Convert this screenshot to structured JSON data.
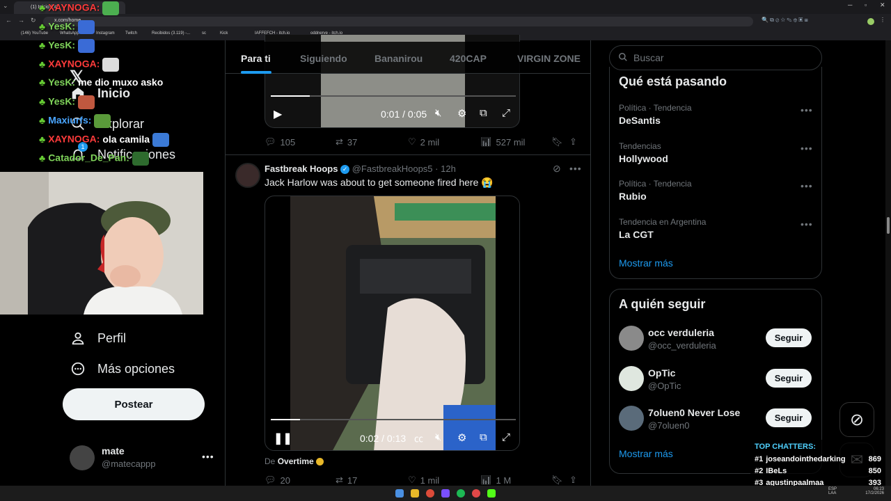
{
  "browser": {
    "tab_title": "(1) Inicio / X",
    "url": "x.com/home",
    "bookmarks": [
      "(146) YouTube",
      "WhatsApp",
      "Instagram",
      "Twitch",
      "Recibidos (3.119) -...",
      "sc",
      "Kick",
      "IAFFEFCH - itch.io",
      "oddnerve - itch.io"
    ]
  },
  "chat": {
    "lines": [
      {
        "user": "XAYNOGA:",
        "msg": "",
        "color": "#ff3b3b",
        "emote": "#4caf50"
      },
      {
        "user": "YesK:",
        "msg": "",
        "color": "#7fd35a",
        "emote": "#3a6bd6"
      },
      {
        "user": "YesK:",
        "msg": "",
        "color": "#7fd35a",
        "emote": "#3a6bd6"
      },
      {
        "user": "XAYNOGA:",
        "msg": "",
        "color": "#ff3b3b",
        "emote": "#dcdcdc"
      },
      {
        "user": "YesK:",
        "msg": "me dio muxo asko",
        "color": "#7fd35a",
        "emote": ""
      },
      {
        "user": "YesK:",
        "msg": "",
        "color": "#7fd35a",
        "emote": "#c0583f"
      },
      {
        "user": "Maxiurfs:",
        "msg": "",
        "color": "#4aa6ff",
        "emote": "#5a9a3a"
      },
      {
        "user": "XAYNOGA:",
        "msg": "ola camila",
        "color": "#ff3b3b",
        "emote": "#3b7ad6"
      },
      {
        "user": "Catador_De_Pan:",
        "msg": "",
        "color": "#7fd35a",
        "emote": "#2e6b2e"
      }
    ]
  },
  "sidebar": {
    "home": "Inicio",
    "explore": "Explorar",
    "notifications": "Notificaciones",
    "notif_count": "1",
    "profile": "Perfil",
    "more": "Más opciones",
    "post": "Postear",
    "account_name": "mate",
    "account_handle": "@matecappp"
  },
  "feed": {
    "tabs": [
      "Para ti",
      "Siguiendo",
      "Bananirou",
      "420CAP",
      "VIRGIN ZONE"
    ],
    "active_tab": "Para ti",
    "post1": {
      "time": "0:01 / 0:05",
      "progress": 0.16,
      "replies": "105",
      "reposts": "37",
      "likes": "2 mil",
      "views": "527 mil"
    },
    "post2": {
      "author": "Fastbreak Hoops",
      "handle": "@FastbreakHoops5",
      "age": "· 12h",
      "text": "Jack Harlow was about to get someone fired here 😭",
      "time": "0:02 / 0:13",
      "progress": 0.12,
      "source_prefix": "De",
      "source": "Overtime",
      "replies": "20",
      "reposts": "17",
      "likes": "1 mil",
      "views": "1 M"
    }
  },
  "right": {
    "search_placeholder": "Buscar",
    "trends_title": "Qué está pasando",
    "trends": [
      {
        "meta": "Política · Tendencia",
        "name": "DeSantis"
      },
      {
        "meta": "Tendencias",
        "name": "Hollywood"
      },
      {
        "meta": "Política · Tendencia",
        "name": "Rubio"
      },
      {
        "meta": "Tendencia en Argentina",
        "name": "La CGT"
      }
    ],
    "trends_more": "Mostrar más",
    "follow_title": "A quién seguir",
    "follow": [
      {
        "name": "occ verduleria",
        "handle": "@occ_verduleria",
        "button": "Seguir",
        "avatar": "#8a8a8a"
      },
      {
        "name": "OpTic",
        "handle": "@OpTic",
        "button": "Seguir",
        "avatar": "#dfe7df"
      },
      {
        "name": "7oluen0 Never Lose",
        "handle": "@7oluen0",
        "button": "Seguir",
        "avatar": "#5a6b7a"
      }
    ],
    "follow_more": "Mostrar más"
  },
  "top_chatters": {
    "title": "TOP CHATTERS:",
    "rows": [
      {
        "rank": "#1",
        "name": "joseandointhedarking",
        "count": "869"
      },
      {
        "rank": "#2",
        "name": "IBeLs",
        "count": "850"
      },
      {
        "rank": "#3",
        "name": "agustinpaalmaa",
        "count": "393"
      }
    ]
  },
  "taskbar": {
    "lang": "ESP LAA",
    "time": "06:23",
    "date": "17/2/2026"
  },
  "colors": {
    "accent": "#1d9bf0",
    "verified_gold": "#e8b829"
  }
}
